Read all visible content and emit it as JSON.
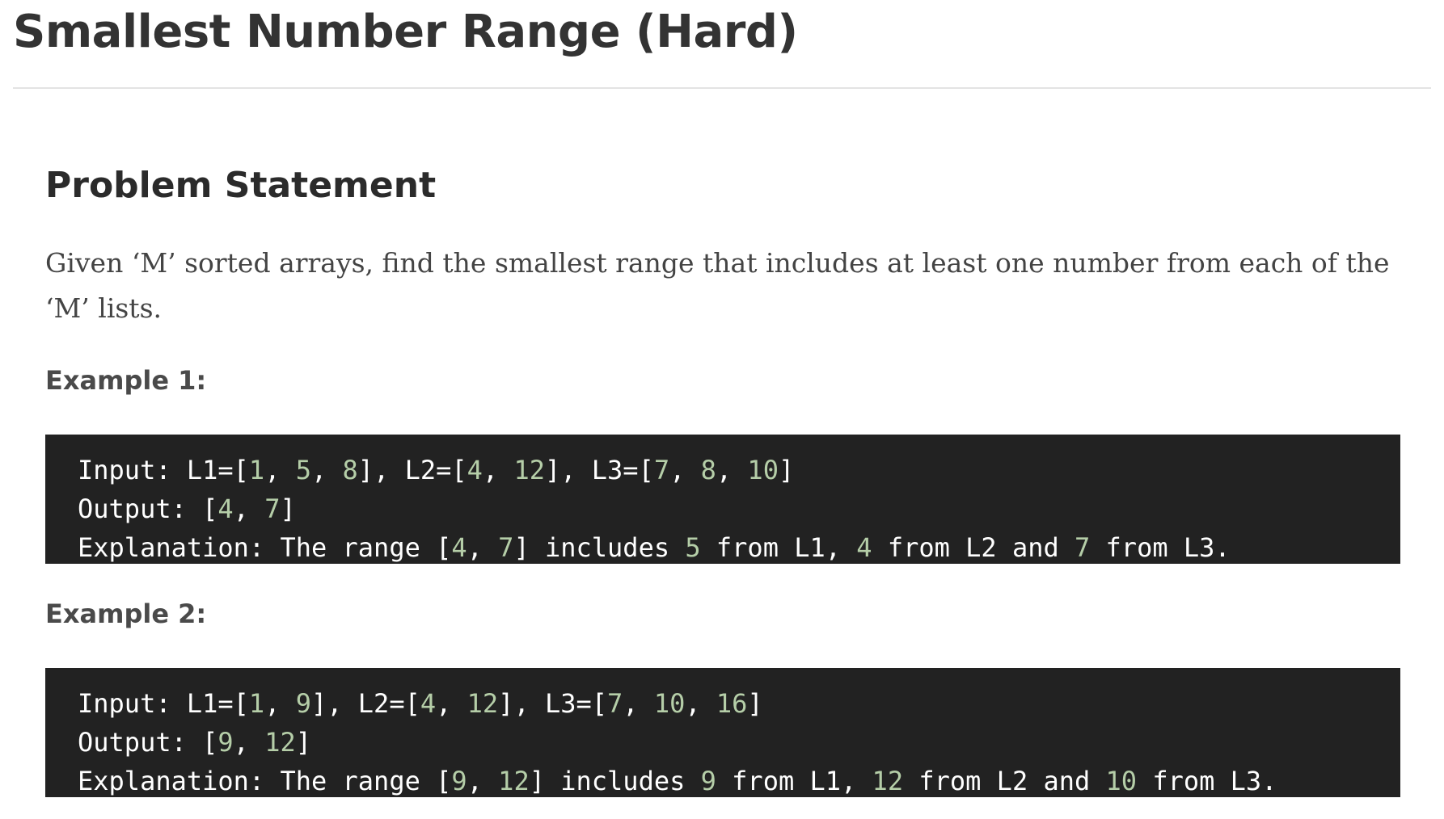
{
  "page": {
    "title": "Smallest Number Range (Hard)"
  },
  "problem": {
    "heading": "Problem Statement",
    "statement": "Given ‘M’ sorted arrays, find the smallest range that includes at least one number from each of the ‘M’ lists."
  },
  "examples": [
    {
      "heading": "Example 1:",
      "lines": [
        [
          {
            "t": "Input: L1=[",
            "n": false
          },
          {
            "t": "1",
            "n": true
          },
          {
            "t": ", ",
            "n": false
          },
          {
            "t": "5",
            "n": true
          },
          {
            "t": ", ",
            "n": false
          },
          {
            "t": "8",
            "n": true
          },
          {
            "t": "], L2=[",
            "n": false
          },
          {
            "t": "4",
            "n": true
          },
          {
            "t": ", ",
            "n": false
          },
          {
            "t": "12",
            "n": true
          },
          {
            "t": "], L3=[",
            "n": false
          },
          {
            "t": "7",
            "n": true
          },
          {
            "t": ", ",
            "n": false
          },
          {
            "t": "8",
            "n": true
          },
          {
            "t": ", ",
            "n": false
          },
          {
            "t": "10",
            "n": true
          },
          {
            "t": "]",
            "n": false
          }
        ],
        [
          {
            "t": "Output: [",
            "n": false
          },
          {
            "t": "4",
            "n": true
          },
          {
            "t": ", ",
            "n": false
          },
          {
            "t": "7",
            "n": true
          },
          {
            "t": "]",
            "n": false
          }
        ],
        [
          {
            "t": "Explanation: The range [",
            "n": false
          },
          {
            "t": "4",
            "n": true
          },
          {
            "t": ", ",
            "n": false
          },
          {
            "t": "7",
            "n": true
          },
          {
            "t": "] includes ",
            "n": false
          },
          {
            "t": "5",
            "n": true
          },
          {
            "t": " from L1, ",
            "n": false
          },
          {
            "t": "4",
            "n": true
          },
          {
            "t": " from L2 and ",
            "n": false
          },
          {
            "t": "7",
            "n": true
          },
          {
            "t": " from L3.",
            "n": false
          }
        ]
      ]
    },
    {
      "heading": "Example 2:",
      "lines": [
        [
          {
            "t": "Input: L1=[",
            "n": false
          },
          {
            "t": "1",
            "n": true
          },
          {
            "t": ", ",
            "n": false
          },
          {
            "t": "9",
            "n": true
          },
          {
            "t": "], L2=[",
            "n": false
          },
          {
            "t": "4",
            "n": true
          },
          {
            "t": ", ",
            "n": false
          },
          {
            "t": "12",
            "n": true
          },
          {
            "t": "], L3=[",
            "n": false
          },
          {
            "t": "7",
            "n": true
          },
          {
            "t": ", ",
            "n": false
          },
          {
            "t": "10",
            "n": true
          },
          {
            "t": ", ",
            "n": false
          },
          {
            "t": "16",
            "n": true
          },
          {
            "t": "]",
            "n": false
          }
        ],
        [
          {
            "t": "Output: [",
            "n": false
          },
          {
            "t": "9",
            "n": true
          },
          {
            "t": ", ",
            "n": false
          },
          {
            "t": "12",
            "n": true
          },
          {
            "t": "]",
            "n": false
          }
        ],
        [
          {
            "t": "Explanation: The range [",
            "n": false
          },
          {
            "t": "9",
            "n": true
          },
          {
            "t": ", ",
            "n": false
          },
          {
            "t": "12",
            "n": true
          },
          {
            "t": "] includes ",
            "n": false
          },
          {
            "t": "9",
            "n": true
          },
          {
            "t": " from L1, ",
            "n": false
          },
          {
            "t": "12",
            "n": true
          },
          {
            "t": " from L2 and ",
            "n": false
          },
          {
            "t": "10",
            "n": true
          },
          {
            "t": " from L3.",
            "n": false
          }
        ]
      ]
    }
  ],
  "colors": {
    "code_background": "#222222",
    "code_text": "#ffffff",
    "code_number": "#b5cea8",
    "title_text": "#333333"
  }
}
